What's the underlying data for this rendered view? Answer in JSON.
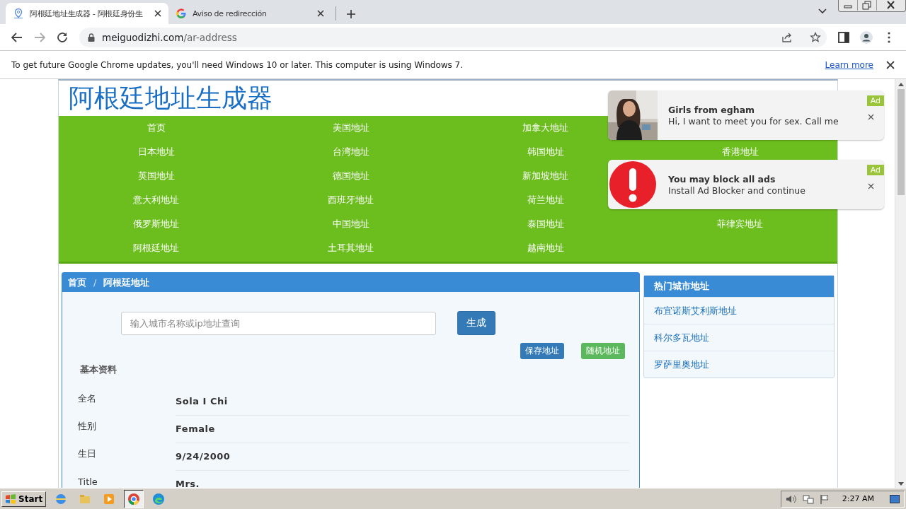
{
  "browser": {
    "tabs": [
      {
        "title": "阿根廷地址生成器 - 阿根廷身份生",
        "selected": true,
        "kind": "pin"
      },
      {
        "title": "Aviso de redirección",
        "selected": false,
        "kind": "google"
      }
    ],
    "address": {
      "domain": "meiguodizhi.com",
      "path": "/ar-address"
    },
    "infobar": {
      "message": "To get future Google Chrome updates, you'll need Windows 10 or later. This computer is using Windows 7.",
      "link": "Learn more"
    }
  },
  "site": {
    "logo": "阿根廷地址生成器",
    "nav": [
      [
        "首页",
        "美国地址",
        "加拿大地址"
      ],
      [
        "日本地址",
        "台湾地址",
        "韩国地址",
        "香港地址"
      ],
      [
        "英国地址",
        "德国地址",
        "新加坡地址"
      ],
      [
        "意大利地址",
        "西班牙地址",
        "荷兰地址"
      ],
      [
        "俄罗斯地址",
        "中国地址",
        "泰国地址",
        "菲律宾地址"
      ],
      [
        "阿根廷地址",
        "土耳其地址",
        "越南地址"
      ]
    ],
    "breadcrumb": [
      "首页",
      "阿根廷地址"
    ],
    "breadcrumb_separator": "/",
    "search": {
      "placeholder": "输入城市名称或ip地址查询"
    },
    "generate_button": "生成",
    "save_button": "保存地址",
    "random_button": "随机地址",
    "section_title": "基本资料",
    "fields": [
      {
        "label": "全名",
        "value": "Sola I Chi"
      },
      {
        "label": "性别",
        "value": "Female"
      },
      {
        "label": "生日",
        "value": "9/24/2000"
      },
      {
        "label": "Title",
        "value": "Mrs."
      }
    ],
    "sidebar": {
      "title": "热门城市地址",
      "items": [
        "布宜诺斯艾利斯地址",
        "科尔多瓦地址",
        "罗萨里奥地址"
      ]
    }
  },
  "ads": [
    {
      "badge": "Ad",
      "title": "Girls from egham",
      "text": "Hi, I want to meet you for sex. Call me"
    },
    {
      "kind": "alert",
      "badge": "Ad",
      "title": "You may block all ads",
      "text": "Install Ad Blocker and continue"
    }
  ],
  "taskbar": {
    "start": "Start",
    "clock": "2:27 AM"
  }
}
